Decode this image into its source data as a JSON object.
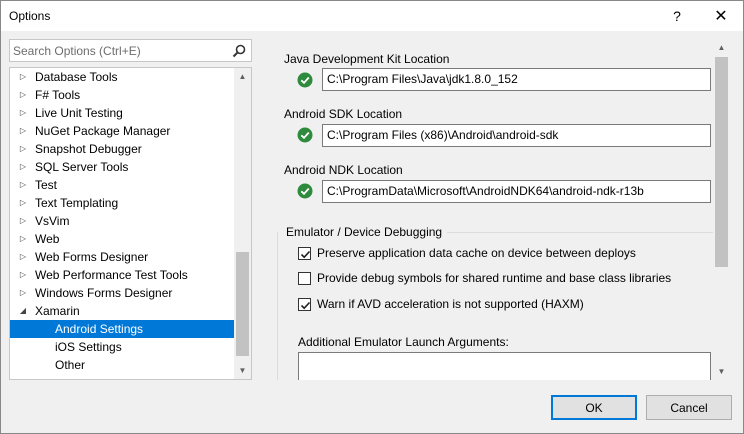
{
  "window": {
    "title": "Options",
    "help_glyph": "?",
    "close_glyph": "✕"
  },
  "search": {
    "placeholder": "Search Options (Ctrl+E)",
    "icon": "search-icon"
  },
  "tree": {
    "items": [
      {
        "label": "Database Tools",
        "level": 0,
        "expander": "collapsed"
      },
      {
        "label": "F# Tools",
        "level": 0,
        "expander": "collapsed"
      },
      {
        "label": "Live Unit Testing",
        "level": 0,
        "expander": "collapsed"
      },
      {
        "label": "NuGet Package Manager",
        "level": 0,
        "expander": "collapsed"
      },
      {
        "label": "Snapshot Debugger",
        "level": 0,
        "expander": "collapsed"
      },
      {
        "label": "SQL Server Tools",
        "level": 0,
        "expander": "collapsed"
      },
      {
        "label": "Test",
        "level": 0,
        "expander": "collapsed"
      },
      {
        "label": "Text Templating",
        "level": 0,
        "expander": "collapsed"
      },
      {
        "label": "VsVim",
        "level": 0,
        "expander": "collapsed"
      },
      {
        "label": "Web",
        "level": 0,
        "expander": "collapsed"
      },
      {
        "label": "Web Forms Designer",
        "level": 0,
        "expander": "collapsed"
      },
      {
        "label": "Web Performance Test Tools",
        "level": 0,
        "expander": "collapsed"
      },
      {
        "label": "Windows Forms Designer",
        "level": 0,
        "expander": "collapsed"
      },
      {
        "label": "Xamarin",
        "level": 0,
        "expander": "expanded"
      },
      {
        "label": "Android Settings",
        "level": 1,
        "expander": "none",
        "selected": true
      },
      {
        "label": "iOS Settings",
        "level": 1,
        "expander": "none"
      },
      {
        "label": "Other",
        "level": 1,
        "expander": "none"
      }
    ]
  },
  "settings": {
    "jdk": {
      "label": "Java Development Kit Location",
      "path": "C:\\Program Files\\Java\\jdk1.8.0_152",
      "status": "valid"
    },
    "sdk": {
      "label": "Android SDK Location",
      "path": "C:\\Program Files (x86)\\Android\\android-sdk",
      "status": "valid"
    },
    "ndk": {
      "label": "Android NDK Location",
      "path": "C:\\ProgramData\\Microsoft\\AndroidNDK64\\android-ndk-r13b",
      "status": "valid"
    },
    "emulator": {
      "group_title": "Emulator / Device Debugging",
      "options": [
        {
          "label": "Preserve application data cache on device between deploys",
          "checked": true
        },
        {
          "label": "Provide debug symbols for shared runtime and base class libraries",
          "checked": false
        },
        {
          "label": "Warn if AVD acceleration is not supported (HAXM)",
          "checked": true
        }
      ],
      "args_label": "Additional Emulator Launch Arguments:",
      "args_value": ""
    }
  },
  "buttons": {
    "ok": "OK",
    "cancel": "Cancel"
  },
  "colors": {
    "accent": "#0078d7",
    "valid": "#2e8b3d"
  }
}
